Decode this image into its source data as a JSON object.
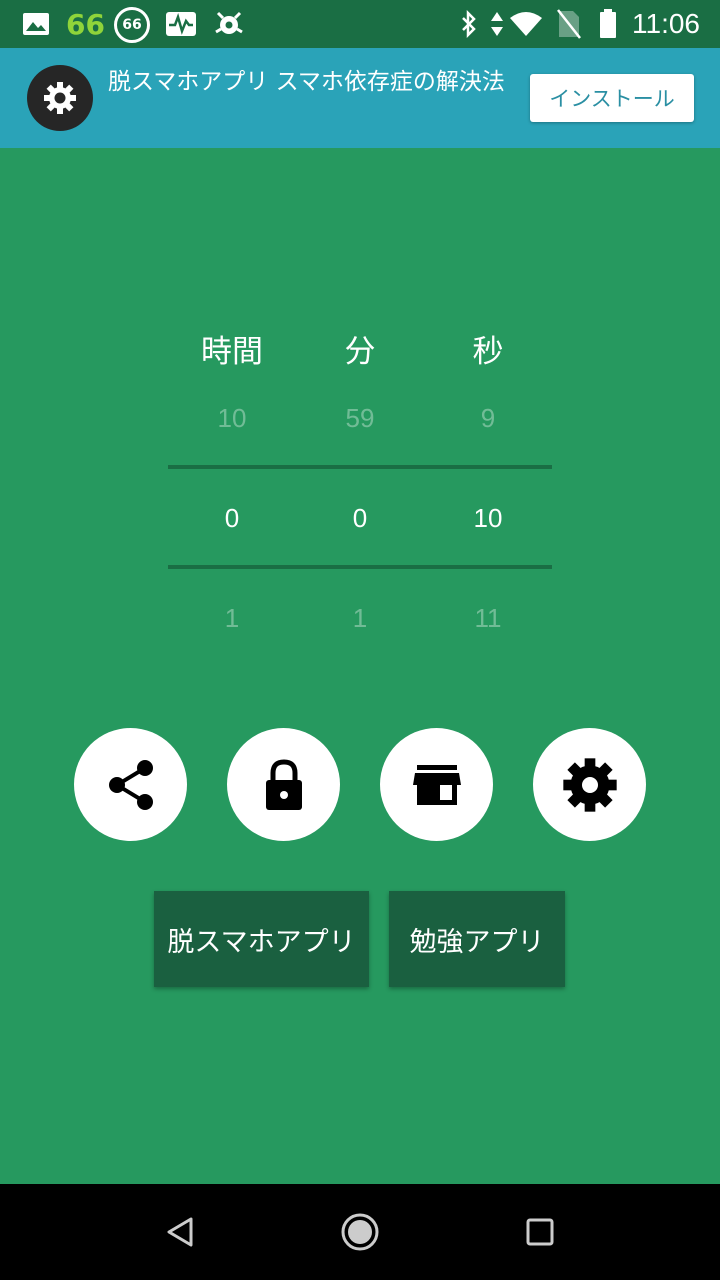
{
  "status_bar": {
    "notification_count": "66",
    "ring_badge": "66",
    "time": "11:06",
    "icons": [
      "image-icon",
      "chart-icon",
      "bug-icon",
      "bluetooth-icon",
      "data-arrows-icon",
      "wifi-icon",
      "no-sim-icon",
      "battery-icon"
    ]
  },
  "ad": {
    "icon": "gear-icon",
    "title": "脱スマホアプリ スマホ依存症の解決法",
    "install_label": "インストール"
  },
  "picker": {
    "labels": [
      "時間",
      "分",
      "秒"
    ],
    "hours": {
      "prev": "10",
      "current": "0",
      "next": "1"
    },
    "minutes": {
      "prev": "59",
      "current": "0",
      "next": "1"
    },
    "seconds": {
      "prev": "9",
      "current": "10",
      "next": "11"
    }
  },
  "actions": [
    "share-icon",
    "lock-icon",
    "store-icon",
    "settings-icon"
  ],
  "buttons": {
    "detox_label": "脱スマホアプリ",
    "study_label": "勉強アプリ"
  },
  "nav": [
    "back-icon",
    "home-icon",
    "recents-icon"
  ]
}
